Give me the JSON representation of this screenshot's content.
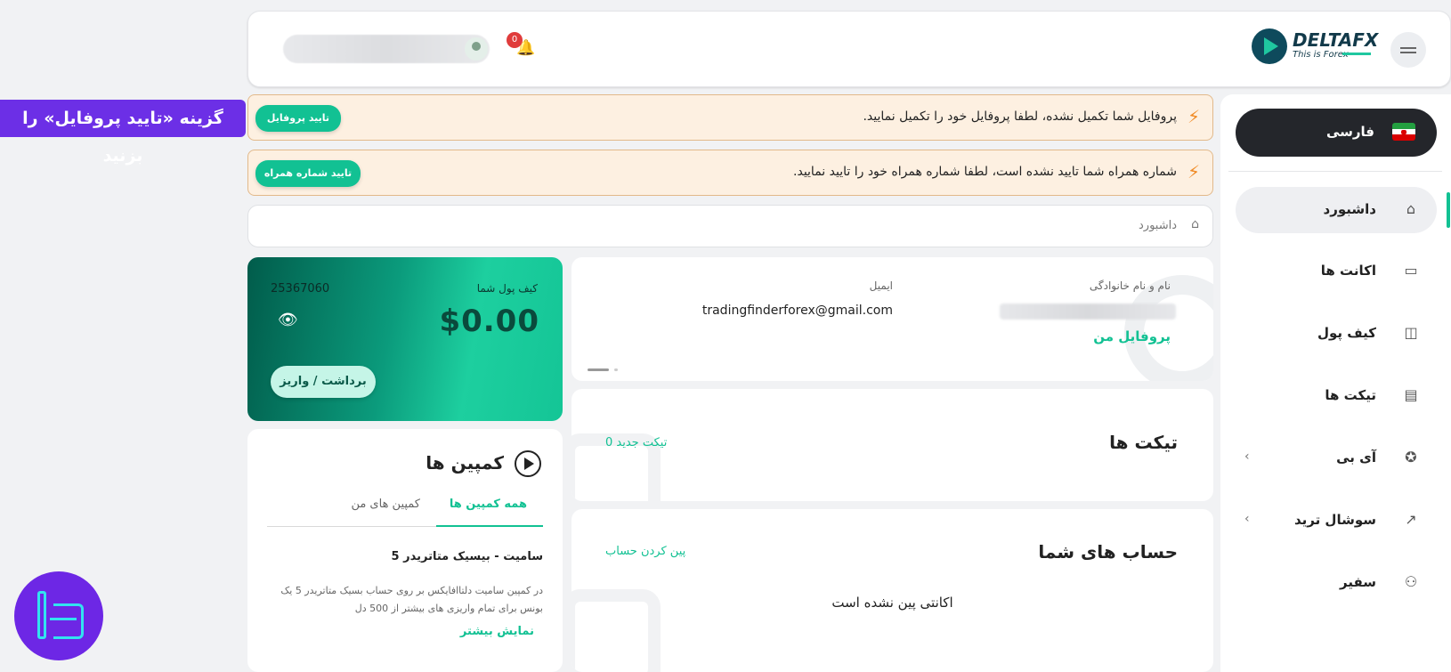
{
  "header": {
    "brand_name": "DELTAFX",
    "brand_tagline": "This is Forex",
    "notification_count": "0"
  },
  "annotation": {
    "text": "گزینه «تایید پروفایل» را بزنید"
  },
  "alerts": [
    {
      "message": "پروفایل شما تکمیل نشده، لطفا پروفایل خود را تکمیل نمایید.",
      "button": "تایید پروفایل"
    },
    {
      "message": "شماره همراه شما تایید نشده است، لطفا شماره همراه خود را تایید نمایید.",
      "button": "تایید شماره همراه"
    }
  ],
  "breadcrumb": {
    "label": "داشبورد"
  },
  "sidebar": {
    "language": "فارسی",
    "items": [
      {
        "label": "داشبورد",
        "icon": "home-icon"
      },
      {
        "label": "اکانت ها",
        "icon": "accounts-icon"
      },
      {
        "label": "کیف پول",
        "icon": "wallet-icon"
      },
      {
        "label": "تیکت ها",
        "icon": "ticket-icon"
      },
      {
        "label": "آی بی",
        "icon": "badge-icon"
      },
      {
        "label": "سوشال ترید",
        "icon": "trend-icon"
      },
      {
        "label": "سفیر",
        "icon": "users-icon"
      }
    ]
  },
  "profile": {
    "name_label": "نام و نام خانوادگی",
    "email_label": "ایمیل",
    "email_value": "tradingfinderforex@gmail.com",
    "link": "پروفایل من"
  },
  "wallet": {
    "title": "کیف پول شما",
    "id": "25367060",
    "amount": "$0.00",
    "button": "برداشت / واریز"
  },
  "tickets": {
    "title": "تیکت ها",
    "new_link": "0 تیکت جدید"
  },
  "accounts": {
    "title": "حساب های شما",
    "pin_link": "پین کردن حساب",
    "empty": "اکانتی پین نشده است"
  },
  "campaigns": {
    "title": "کمپین ها",
    "tabs": [
      "همه کمپین ها",
      "کمپین های من"
    ],
    "item_title": "سامیت - بیسیک متاتریدر 5",
    "item_desc": "در کمپین سامیت دلتاافایکس بر روی حساب بسیک متاتریدر 5 یک بونس برای تمام واریزی های بیشتر از 500 دل",
    "more": "نمایش بیشتر"
  },
  "colors": {
    "accent": "#12c193",
    "annotation_bg": "#6c2fe6",
    "alert_bg": "#fdf0e1"
  }
}
